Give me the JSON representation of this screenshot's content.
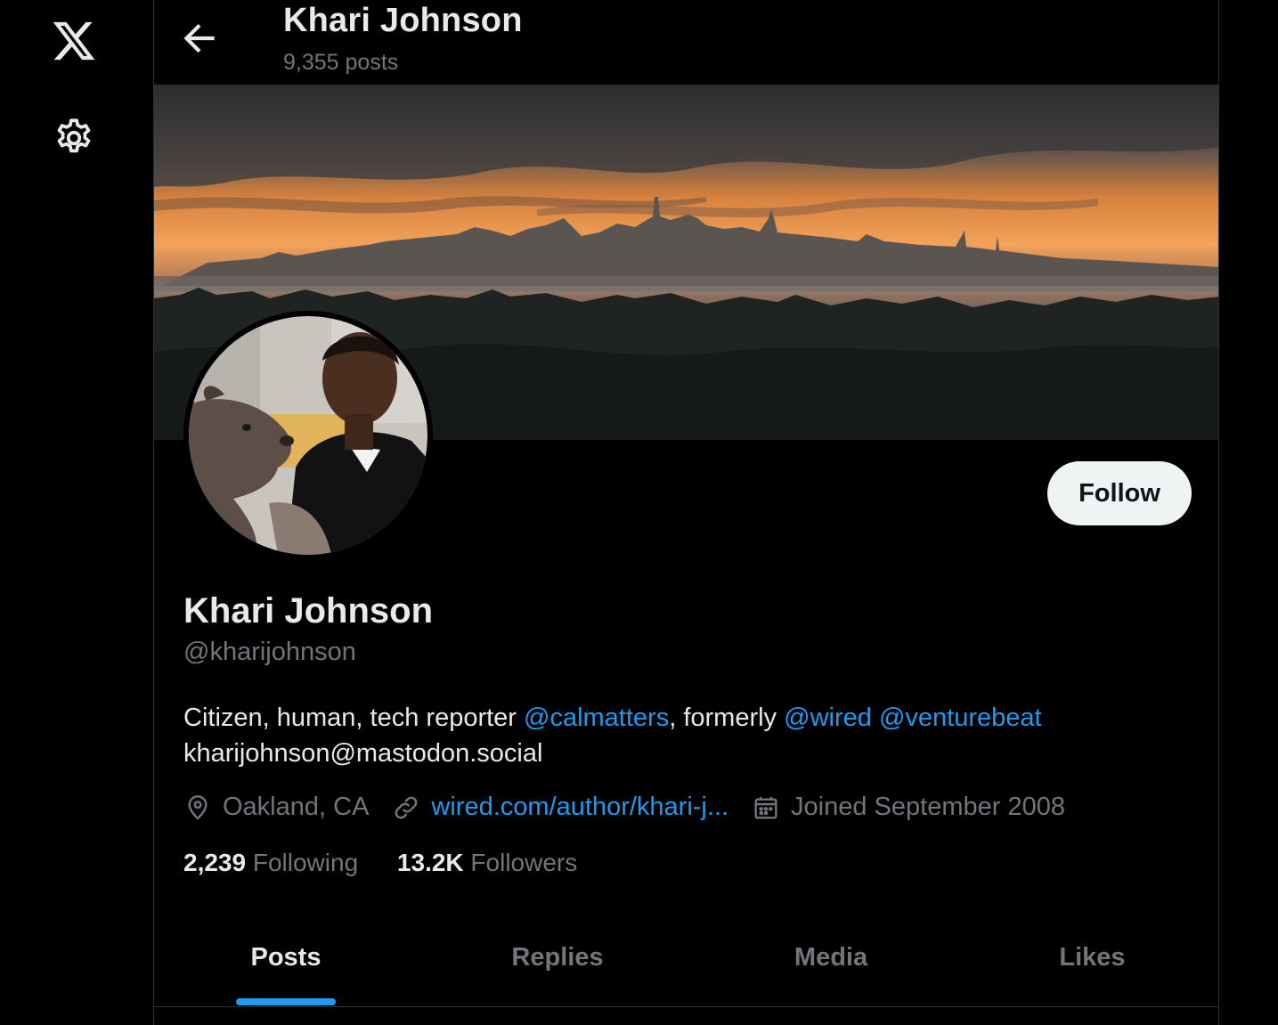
{
  "nav": {
    "logo_icon": "x-logo-icon",
    "settings_icon": "gear-icon"
  },
  "header": {
    "name": "Khari Johnson",
    "posts_count": "9,355 posts"
  },
  "profile": {
    "display_name": "Khari Johnson",
    "handle": "@kharijohnson",
    "follow_label": "Follow",
    "bio": {
      "text1": "Citizen, human, tech reporter ",
      "mention1": "@calmatters",
      "text2": ", formerly ",
      "mention2": "@wired",
      "text3": " ",
      "mention3": "@venturebeat",
      "line2": "kharijohnson@mastodon.social"
    },
    "location": "Oakland, CA",
    "website": "wired.com/author/khari-j...",
    "joined": "Joined September 2008",
    "following_count": "2,239",
    "following_label": "Following",
    "followers_count": "13.2K",
    "followers_label": "Followers"
  },
  "tabs": [
    {
      "label": "Posts",
      "active": true
    },
    {
      "label": "Replies",
      "active": false
    },
    {
      "label": "Media",
      "active": false
    },
    {
      "label": "Likes",
      "active": false
    }
  ],
  "colors": {
    "background": "#000000",
    "accent": "#1d9bf0",
    "text_primary": "#e7e9ea",
    "text_secondary": "#71767b",
    "follow_button_bg": "#eff3f4"
  }
}
